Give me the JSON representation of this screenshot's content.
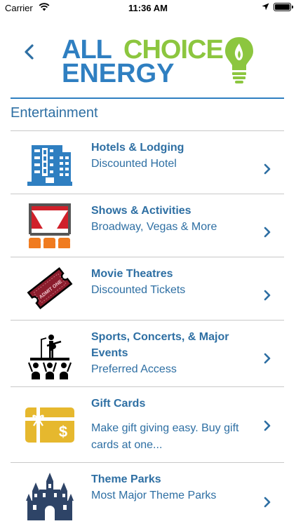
{
  "status": {
    "carrier": "Carrier",
    "time": "11:36 AM"
  },
  "header": {
    "logo_all": "ALL",
    "logo_choice": "CHOICE",
    "logo_energy": "ENERGY"
  },
  "section": {
    "title": "Entertainment"
  },
  "items": [
    {
      "title": "Hotels & Lodging",
      "subtitle": "Discounted Hotel",
      "icon": "hotel-icon"
    },
    {
      "title": "Shows & Activities",
      "subtitle": "Broadway, Vegas & More",
      "icon": "theater-stage-icon"
    },
    {
      "title": "Movie Theatres",
      "subtitle": "Discounted Tickets",
      "icon": "movie-ticket-icon",
      "ticket_text": "ADMIT ONE"
    },
    {
      "title": "Sports, Concerts, & Major Events",
      "subtitle": "Preferred Access",
      "icon": "concert-icon"
    },
    {
      "title": "Gift Cards",
      "subtitle": "Make gift giving easy. Buy gift cards at one...",
      "icon": "gift-card-icon",
      "card_symbol": "$"
    },
    {
      "title": "Theme Parks",
      "subtitle": "Most Major Theme Parks",
      "icon": "castle-icon"
    }
  ],
  "colors": {
    "brand_blue": "#2f7fc1",
    "brand_green": "#8cc63f",
    "text_blue": "#2e6fa3"
  }
}
